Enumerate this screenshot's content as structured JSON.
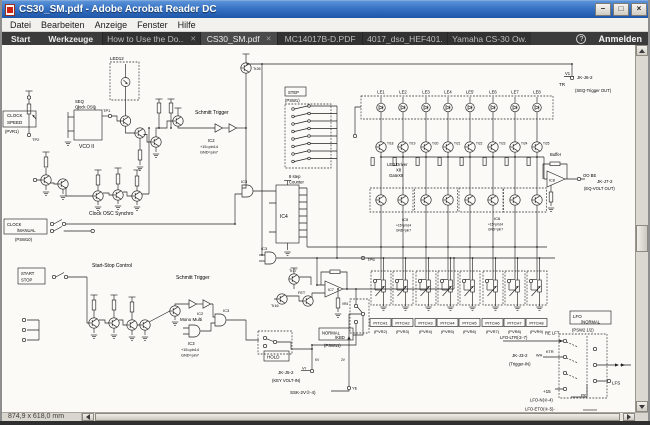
{
  "colors": {
    "titlebar_blue": "#3672c4",
    "tabbar_gray": "#3b3b3b",
    "page_white": "#fbfaf7",
    "ink": "#222222",
    "chrome_gray": "#d9d6cf"
  },
  "window": {
    "title": "CS30_SM.pdf - Adobe Acrobat Reader DC",
    "controls": {
      "minimize": "–",
      "maximize": "□",
      "close": "×"
    }
  },
  "menu_bar": {
    "items": [
      "Datei",
      "Bearbeiten",
      "Anzeige",
      "Fenster",
      "Hilfe"
    ]
  },
  "tab_bar": {
    "start": "Start",
    "tools": "Werkzeuge",
    "tabs": [
      {
        "label": "How to Use the Do..."
      },
      {
        "label": "CS30_SM.pdf"
      },
      {
        "label": "MC14017B-D.PDF"
      },
      {
        "label": "4017_dso_HEF401..."
      },
      {
        "label": "Yamaha CS-30 Ow..."
      }
    ],
    "close_glyph": "✕",
    "help_glyph": "?",
    "sign_in": "Anmelden"
  },
  "status_bar": {
    "page_size": "874,9 x 618,0 mm"
  },
  "schematic": {
    "labels": {
      "led12": "LED12",
      "clock_speed1": "CLOCK",
      "clock_speed2": "SPEED",
      "pvr1": "(PVR1)",
      "tp2": "TP2",
      "seq": "SEQ",
      "clock_osc": "Clock OSC",
      "tp1": "TP1",
      "vco2": "VCO II",
      "schmitt1": "Schmitt Trigger",
      "ic2a": "IC2",
      "ic2a_p1": "+15=pin14",
      "ic2a_p2": "GND=pin7",
      "tr26": "Tr26",
      "clock_osc_synchro": "Clock OSC Synchro",
      "clock1": "CLOCK",
      "manual1": "/MANUAL",
      "psw10": "(PSW10)",
      "start1": "START",
      "stop1": "STOP",
      "start_stop_control": "Start-Stop Control",
      "schmitt2": "Schmitt Trigger",
      "ic2b": "IC2",
      "mono_multi": "Mono Multi",
      "ic3a": "IC3",
      "ic3a_p1": "+15=pin14",
      "ic3a_p2": "GND=pin7",
      "g1": "IC3",
      "g2": "IC3",
      "g4": "IC3",
      "step": "STEP",
      "psw1": "(PSW1)",
      "counter1": "8 step",
      "counter2": "Counter",
      "ic4": "IC4",
      "led_driver1": "LED Driver",
      "led_driver2": "X8",
      "led_driver3": "GateX8",
      "ic5": "IC5",
      "ic5_p1": "+15=pin14",
      "ic5_p2": "GND=pin7",
      "ic6": "IC6",
      "ic6_p1": "+15=pin14",
      "ic6_p2": "GND=pin7",
      "v1": "V1",
      "jk_j6_2": "JK-J6-2",
      "tr": "TR",
      "seq_trigger_out": "(SEQ-Trigger OUT)",
      "buffer": "Buffer",
      "ic8": "IC8",
      "oo_be": "OO BE",
      "jk_j7_2": "JK-J7-2",
      "eq_volt_out": "(EQ-VOLT OUT)",
      "tp6": "TP6",
      "ic7": "IC7",
      "tr16": "Tr16",
      "tr17": "Tr17",
      "fet": "FET",
      "vr4": "VR4",
      "normal1": "NORMAL",
      "kbd": "/KBD",
      "psw11": "(PSW11)",
      "hold": "HOLD",
      "jk_j5_2": "JK-J5-2",
      "vi2": "VI",
      "key_volt_in": "(KEY VOLT-IN)",
      "kv": "KV",
      "ssk": "SSK-2V②-4)",
      "ye": "YE",
      "v2v": "2V",
      "lfo1": "LFO",
      "lfo2": "/NORMAL",
      "psw2": "(PSW2 1/2)",
      "lfo_ltr": "LFO-LTR(②-7)",
      "re_lft": "RE LFT",
      "jk_j3_2": "JK-J3-2",
      "trigger_in": "(Trigger-IN)",
      "wh": "WH",
      "ktr": "KTR",
      "plus15": "+15",
      "lfo_n": "LFO-N(②-4)",
      "pk": "PK",
      "lfs": "LFS",
      "lfo_eto": "LFO-ETO(②-5)-"
    },
    "le": [
      "LE1",
      "LE2",
      "LE3",
      "LE4",
      "LE5'",
      "LE6",
      "LE7",
      "LE8"
    ],
    "tr_drivers": [
      "Tr18",
      "Tr19",
      "Tr20",
      "Tr21",
      "Tr22",
      "Tr23",
      "Tr24",
      "Tr25"
    ],
    "pitch": [
      {
        "name": "PITCH1",
        "pvr": "(PVR2)"
      },
      {
        "name": "PITCH2",
        "pvr": "(PVR3)"
      },
      {
        "name": "PITCH3",
        "pvr": "(PVR4)"
      },
      {
        "name": "PITCH4",
        "pvr": "(PVR5)"
      },
      {
        "name": "PITCH5",
        "pvr": "(PVR6)"
      },
      {
        "name": "PITCH6",
        "pvr": "(PVR7)"
      },
      {
        "name": "PITCH7",
        "pvr": "(PVR8)"
      },
      {
        "name": "PITCH8",
        "pvr": "(PVR9)"
      }
    ]
  }
}
